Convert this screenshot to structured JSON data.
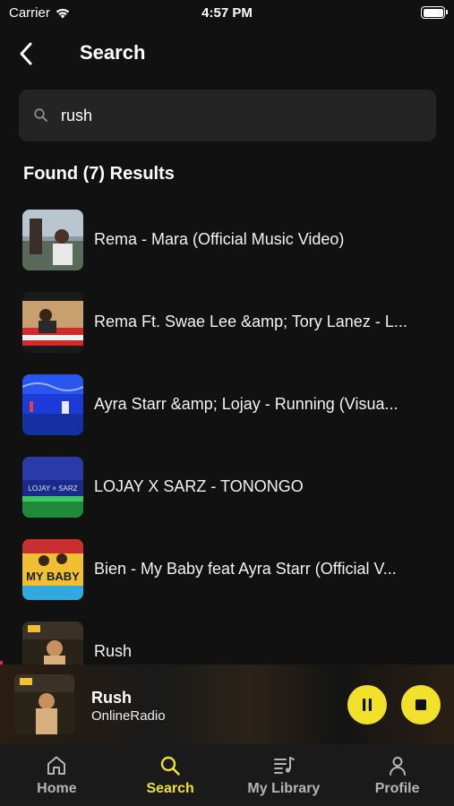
{
  "status_bar": {
    "carrier": "Carrier",
    "time": "4:57 PM"
  },
  "header": {
    "title": "Search"
  },
  "search": {
    "value": "rush",
    "placeholder": ""
  },
  "results_heading": "Found (7) Results",
  "results": [
    {
      "title": "Rema - Mara (Official Music Video)"
    },
    {
      "title": "Rema Ft. Swae Lee &amp; Tory Lanez - L..."
    },
    {
      "title": "Ayra Starr &amp; Lojay - Running (Visua..."
    },
    {
      "title": "LOJAY X SARZ - TONONGO"
    },
    {
      "title": "Bien - My Baby feat Ayra Starr (Official V..."
    },
    {
      "title": "Rush"
    }
  ],
  "thumb_text": {
    "lojay": "LOJAY × SARZ",
    "mybaby": "MY BABY"
  },
  "now_playing": {
    "title": "Rush",
    "subtitle": "OnlineRadio"
  },
  "tabs": [
    {
      "label": "Home",
      "icon": "home-icon",
      "active": false
    },
    {
      "label": "Search",
      "icon": "search-icon",
      "active": true
    },
    {
      "label": "My Library",
      "icon": "library-icon",
      "active": false
    },
    {
      "label": "Profile",
      "icon": "profile-icon",
      "active": false
    }
  ],
  "colors": {
    "accent": "#f2e12a",
    "background": "#111111",
    "surface": "#242424"
  }
}
